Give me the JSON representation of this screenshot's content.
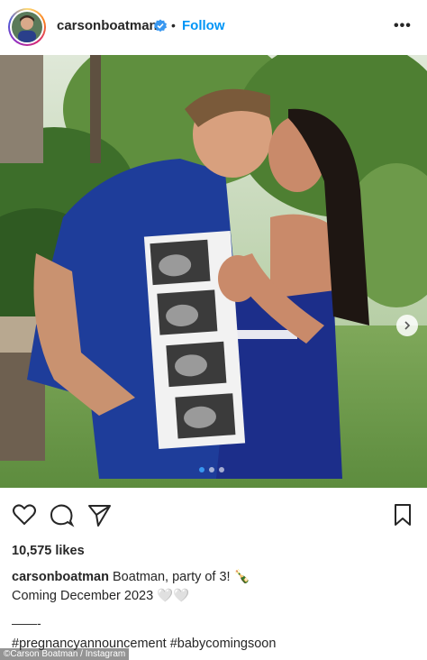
{
  "post": {
    "username": "carsonboatman",
    "follow_label": "Follow",
    "separator": "•",
    "more_label": "•••",
    "likes": "10,575 likes",
    "caption_user": "carsonboatman",
    "caption_text": "Boatman, party of 3! 🍾",
    "caption_line2": "Coming December 2023 🤍🤍",
    "divider": "——-",
    "hashtags": "#pregnancyannouncement #babycomingsoon",
    "credit": "©Carson Boatman / Instagram"
  },
  "icons": {
    "verified": "verified-badge-icon",
    "like": "heart-icon",
    "comment": "comment-icon",
    "share": "send-icon",
    "save": "bookmark-icon",
    "next": "chevron-right-icon"
  },
  "carousel": {
    "total": 3,
    "active": 1
  },
  "colors": {
    "follow": "#0095f6",
    "verified": "#3897f0",
    "text": "#262626"
  }
}
